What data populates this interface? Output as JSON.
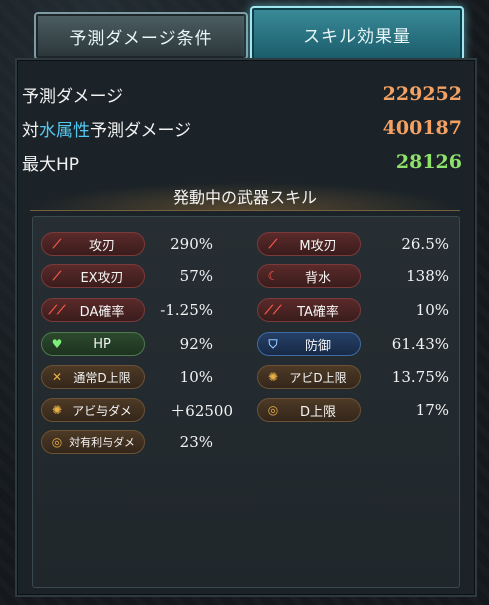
{
  "tabs": {
    "conditions": "予測ダメージ条件",
    "skill_effect": "スキル効果量"
  },
  "stats": {
    "damage_label": "予測ダメージ",
    "damage_value": "229252",
    "attr_prefix": "対",
    "attr_name": "水属性",
    "attr_suffix": "予測ダメージ",
    "attr_damage_value": "400187",
    "hp_label": "最大HP",
    "hp_value": "28126"
  },
  "section_title": "発動中の武器スキル",
  "skills": {
    "left": [
      {
        "label": "攻刃",
        "value": "290%",
        "color": "red",
        "icon": "sword-icon"
      },
      {
        "label": "EX攻刃",
        "value": "57%",
        "color": "red",
        "icon": "sword-icon"
      },
      {
        "label": "DA確率",
        "value": "-1.25%",
        "color": "red",
        "icon": "double-attack-icon"
      },
      {
        "label": "HP",
        "value": "92%",
        "color": "green",
        "icon": "heart-icon"
      },
      {
        "label": "通常D上限",
        "value": "10%",
        "color": "brown",
        "icon": "damage-cap-icon"
      },
      {
        "label": "アビ与ダメ",
        "value": "＋62500",
        "color": "brown",
        "icon": "ability-damage-icon"
      },
      {
        "label": "対有利与ダメ",
        "value": "23%",
        "color": "brown",
        "icon": "ring-icon"
      }
    ],
    "right": [
      {
        "label": "M攻刃",
        "value": "26.5%",
        "color": "red",
        "icon": "sword-icon"
      },
      {
        "label": "背水",
        "value": "138%",
        "color": "red",
        "icon": "wave-icon"
      },
      {
        "label": "TA確率",
        "value": "10%",
        "color": "red",
        "icon": "triple-attack-icon"
      },
      {
        "label": "防御",
        "value": "61.43%",
        "color": "blue",
        "icon": "shield-icon"
      },
      {
        "label": "アビD上限",
        "value": "13.75%",
        "color": "brown",
        "icon": "ability-cap-icon"
      },
      {
        "label": "D上限",
        "value": "17%",
        "color": "brown",
        "icon": "ring-icon"
      }
    ]
  }
}
